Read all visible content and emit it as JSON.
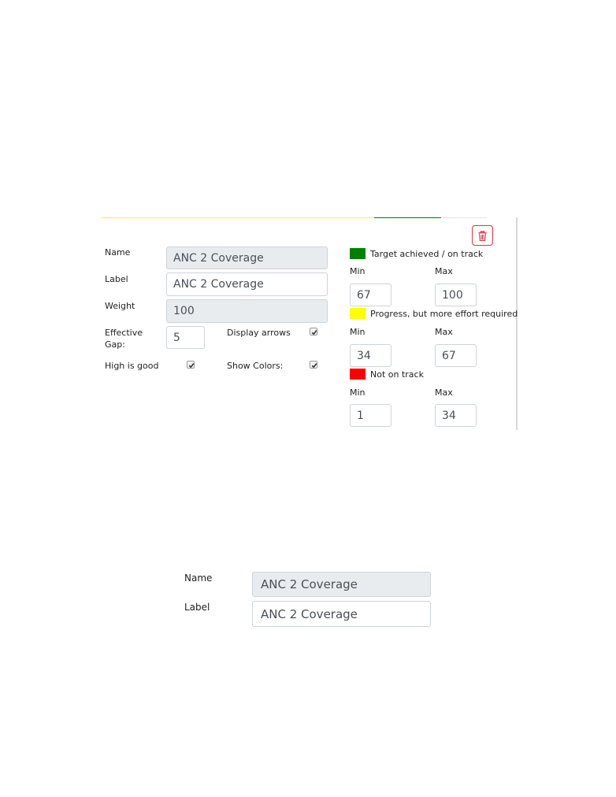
{
  "colors": {
    "accent_green": "#008000",
    "accent_yellow": "#ffff00",
    "accent_red": "#ff0000",
    "danger": "#dc3545"
  },
  "form": {
    "name_label": "Name",
    "name_value": "ANC 2 Coverage",
    "label_label": "Label",
    "label_value": "ANC 2 Coverage",
    "weight_label": "Weight",
    "weight_value": "100",
    "effective_gap_label_1": "Effective",
    "effective_gap_label_2": "Gap:",
    "effective_gap_value": "5",
    "display_arrows_label": "Display arrows",
    "display_arrows_checked": true,
    "high_is_good_label": "High is good",
    "high_is_good_checked": true,
    "show_colors_label": "Show Colors:",
    "show_colors_checked": true,
    "delete_icon": "trash-icon"
  },
  "thresholds": [
    {
      "color": "#008000",
      "label": "Target achieved / on track",
      "min_label": "Min",
      "max_label": "Max",
      "min": "67",
      "max": "100"
    },
    {
      "color": "#ffff00",
      "label": "Progress, but more effort required",
      "min_label": "Min",
      "max_label": "Max",
      "min": "34",
      "max": "67"
    },
    {
      "color": "#ff0000",
      "label": "Not on track",
      "min_label": "Min",
      "max_label": "Max",
      "min": "1",
      "max": "34"
    }
  ],
  "zoom": {
    "name_label": "Name",
    "name_value": "ANC 2 Coverage",
    "label_label": "Label",
    "label_value": "ANC 2 Coverage"
  }
}
